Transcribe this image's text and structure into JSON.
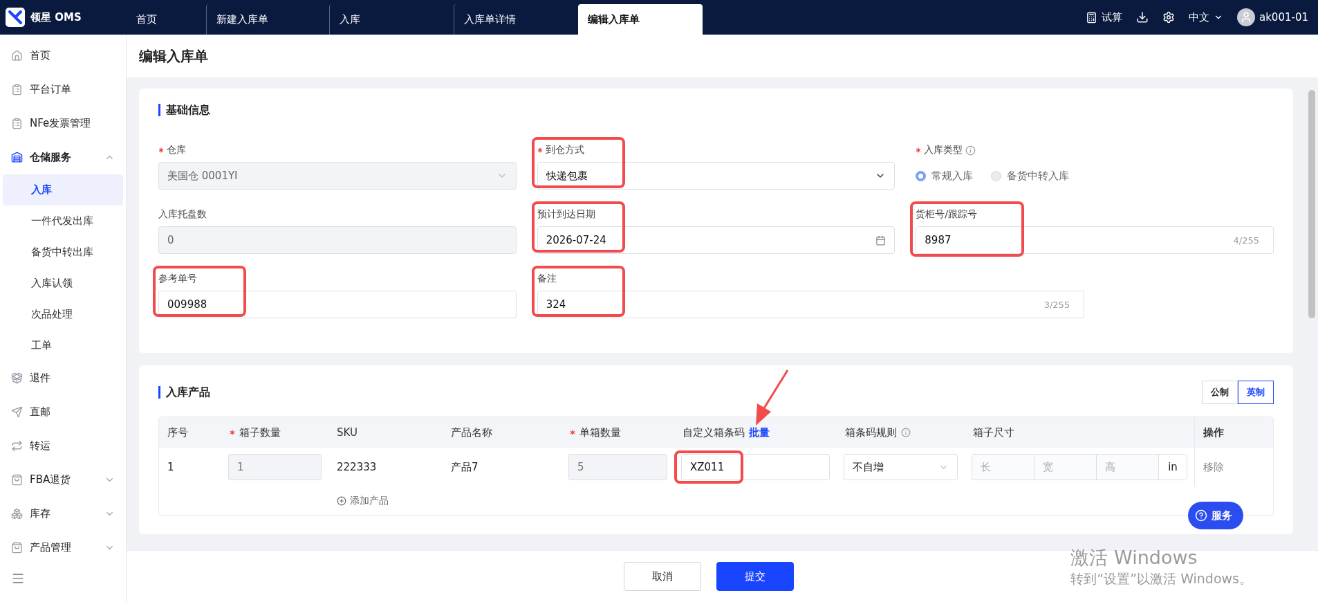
{
  "app": {
    "name": "领星 OMS"
  },
  "tabs": [
    {
      "label": "首页",
      "selected": false
    },
    {
      "label": "新建入库单",
      "selected": false
    },
    {
      "label": "入库",
      "selected": false
    },
    {
      "label": "入库单详情",
      "selected": false
    },
    {
      "label": "编辑入库单",
      "selected": true
    }
  ],
  "header_actions": {
    "trial": "试算",
    "language": "中文",
    "user": "ak001-01"
  },
  "sidebar": {
    "items": [
      {
        "label": "首页",
        "kind": "link"
      },
      {
        "label": "平台订单",
        "kind": "link"
      },
      {
        "label": "NFe发票管理",
        "kind": "link"
      },
      {
        "label": "仓储服务",
        "kind": "group",
        "expanded": true,
        "children": [
          {
            "label": "入库",
            "selected": true
          },
          {
            "label": "一件代发出库",
            "selected": false
          },
          {
            "label": "备货中转出库",
            "selected": false
          },
          {
            "label": "入库认领",
            "selected": false
          },
          {
            "label": "次品处理",
            "selected": false
          },
          {
            "label": "工单",
            "selected": false
          }
        ]
      },
      {
        "label": "退件",
        "kind": "link"
      },
      {
        "label": "直邮",
        "kind": "link"
      },
      {
        "label": "转运",
        "kind": "link"
      },
      {
        "label": "FBA退货",
        "kind": "group",
        "expanded": false
      },
      {
        "label": "库存",
        "kind": "group",
        "expanded": false
      },
      {
        "label": "产品管理",
        "kind": "group",
        "expanded": false
      }
    ]
  },
  "page_title": "编辑入库单",
  "basic_info": {
    "title": "基础信息",
    "fields": [
      {
        "kind": "select",
        "label": "仓库",
        "required": true,
        "value": "美国仓 0001YI",
        "disabled": true,
        "highlighted": false
      },
      {
        "kind": "select",
        "label": "到仓方式",
        "required": true,
        "value": "快递包裹",
        "disabled": false,
        "highlighted": true
      },
      {
        "kind": "radio",
        "label": "入库类型",
        "required": true,
        "info": true,
        "options": [
          {
            "label": "常规入库",
            "selected": true
          },
          {
            "label": "备货中转入库",
            "selected": false
          }
        ]
      },
      {
        "kind": "input",
        "label": "入库托盘数",
        "required": false,
        "value": "0",
        "disabled": true,
        "highlighted": false
      },
      {
        "kind": "date",
        "label": "预计到达日期",
        "required": false,
        "value": "2026-07-24",
        "disabled": false,
        "highlighted": true
      },
      {
        "kind": "textarea",
        "label": "货柜号/跟踪号",
        "required": false,
        "value": "8987",
        "counter": "4/255",
        "disabled": false,
        "highlighted": true
      },
      {
        "kind": "input",
        "label": "参考单号",
        "required": false,
        "value": "009988",
        "disabled": false,
        "highlighted": true
      },
      {
        "kind": "textarea",
        "label": "备注",
        "required": false,
        "value": "324",
        "counter": "3/255",
        "disabled": false,
        "highlighted": true,
        "wide": true
      }
    ]
  },
  "products": {
    "title": "入库产品",
    "units": [
      {
        "label": "公制",
        "selected": false
      },
      {
        "label": "英制",
        "selected": true
      }
    ],
    "columns": [
      {
        "label": "序号",
        "required": false
      },
      {
        "label": "箱子数量",
        "required": true
      },
      {
        "label": "SKU",
        "required": false
      },
      {
        "label": "产品名称",
        "required": false
      },
      {
        "label": "单箱数量",
        "required": true
      },
      {
        "label": "自定义箱条码",
        "required": false,
        "link": "批量",
        "arrow": true
      },
      {
        "label": "箱条码规则",
        "required": false,
        "info": true
      },
      {
        "label": "箱子尺寸",
        "required": false
      },
      {
        "label": "操作",
        "required": false
      }
    ],
    "rows": [
      {
        "index": "1",
        "box_count": "1",
        "sku": "222333",
        "product_name": "产品7",
        "per_box": "5",
        "box_code": "XZ011",
        "box_code_highlighted": true,
        "rule": "不自增",
        "dims": [
          "长",
          "宽",
          "高"
        ],
        "unit": "in",
        "action": "移除"
      }
    ],
    "add_product": "添加产品"
  },
  "footer": {
    "cancel": "取消",
    "submit": "提交"
  },
  "service_button": "服务",
  "os_notice": {
    "title": "激活 Windows",
    "text": "转到“设置”以激活 Windows。"
  }
}
